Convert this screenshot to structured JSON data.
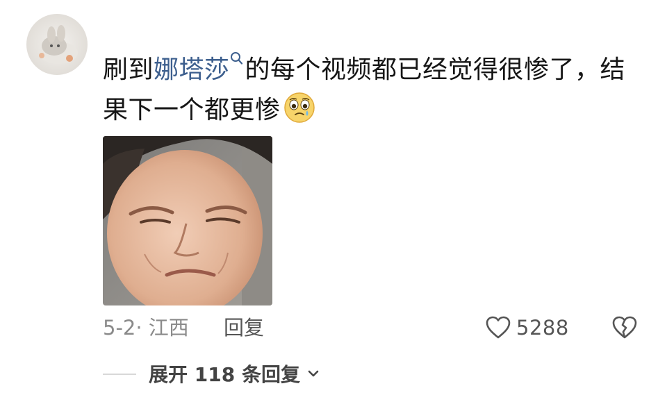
{
  "comment": {
    "text_before": "刷到",
    "mention": "娜塔莎",
    "text_after": "的每个视频都已经觉得很惨了，结果下一个都更惨",
    "emoji": "pleading-face-emoji"
  },
  "meta": {
    "date_location": "5-2· 江西",
    "reply_label": "回复",
    "like_count": "5288"
  },
  "replies": {
    "expand_label": "展开 118 条回复"
  },
  "colors": {
    "mention": "#3d5f8e",
    "meta_gray": "#8a8a8a",
    "icon_gray": "#555555"
  }
}
